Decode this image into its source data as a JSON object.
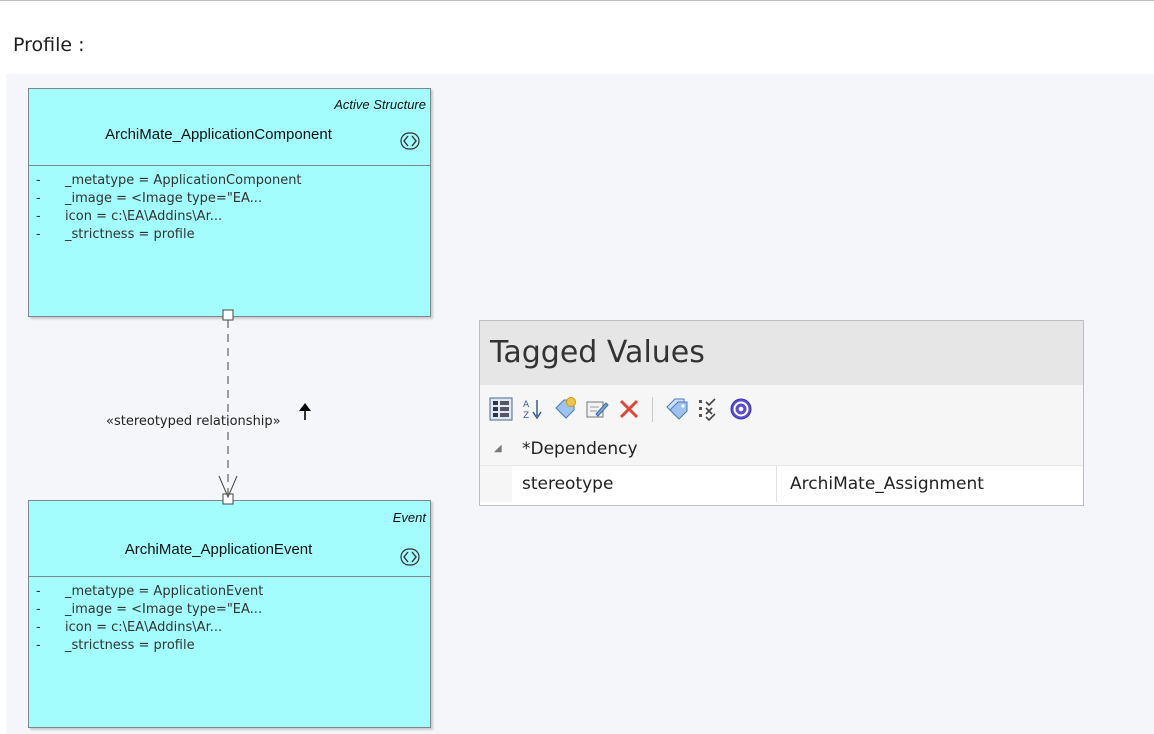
{
  "page": {
    "title": "Profile :"
  },
  "diagram": {
    "source_element": {
      "stereotype": "Active Structure",
      "name": "ArchiMate_ApplicationComponent",
      "icon": "archimate-symbol-icon",
      "attributes": [
        {
          "bullet": "-",
          "text": "_metatype = ApplicationComponent"
        },
        {
          "bullet": "-",
          "text": "_image = <Image type=\"EA..."
        },
        {
          "bullet": "-",
          "text": "icon = c:\\EA\\Addins\\Ar..."
        },
        {
          "bullet": "-",
          "text": "_strictness = profile"
        }
      ]
    },
    "relationship": {
      "label": "«stereotyped relationship»"
    },
    "target_element": {
      "stereotype": "Event",
      "name": "ArchiMate_ApplicationEvent",
      "icon": "archimate-symbol-icon",
      "attributes": [
        {
          "bullet": "-",
          "text": "_metatype = ApplicationEvent"
        },
        {
          "bullet": "-",
          "text": "_image = <Image type=\"EA..."
        },
        {
          "bullet": "-",
          "text": "icon = c:\\EA\\Addins\\Ar..."
        },
        {
          "bullet": "-",
          "text": "_strictness = profile"
        }
      ]
    }
  },
  "tagged_values": {
    "title": "Tagged Values",
    "toolbar": [
      "categorized-view-icon",
      "sort-alphabetical-icon",
      "new-tag-icon",
      "edit-tag-icon",
      "delete-icon",
      "tag-groups-icon",
      "checklist-icon",
      "help-icon"
    ],
    "group": {
      "label": "*Dependency"
    },
    "rows": [
      {
        "name": "stereotype",
        "value": "ArchiMate_Assignment"
      }
    ]
  },
  "colors": {
    "element_fill": "#a3fdfd",
    "canvas": "#f4f6f9",
    "panel_header": "#e6e6e6"
  }
}
